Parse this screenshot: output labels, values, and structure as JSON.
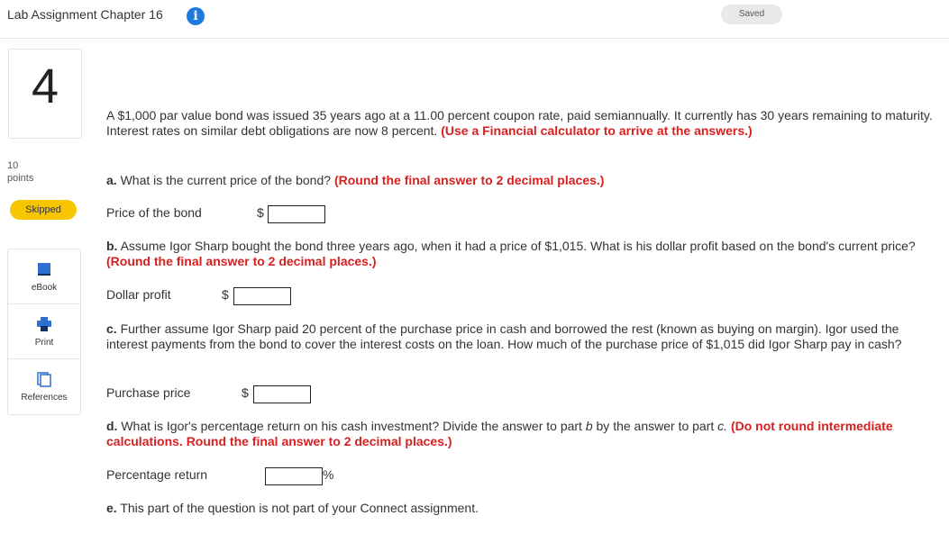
{
  "header": {
    "title": "Lab Assignment Chapter 16",
    "info_icon": "info-icon",
    "saved_label": "Saved"
  },
  "question": {
    "number": "4",
    "points_value": "10",
    "points_label": "points",
    "status": "Skipped"
  },
  "tools": [
    {
      "label": "eBook",
      "icon": "book-icon"
    },
    {
      "label": "Print",
      "icon": "printer-icon"
    },
    {
      "label": "References",
      "icon": "references-icon"
    }
  ],
  "content": {
    "intro": "A $1,000 par value bond was issued 35 years ago at a 11.00 percent coupon rate, paid semiannually. It currently has 30 years remaining to maturity. Interest rates on similar debt obligations are now 8 percent.",
    "intro_red": "(Use a Financial calculator to arrive at the answers.)",
    "a_label": "a.",
    "a_text": "What is the current price of the bond?",
    "a_red": "(Round the final answer to 2 decimal places.)",
    "a_field_label": "Price of the bond",
    "b_label": "b.",
    "b_text": "Assume Igor Sharp bought the bond three years ago, when it had a price of $1,015. What is his dollar profit based on the bond's current price?",
    "b_red": "(Round the final answer to 2 decimal places.)",
    "b_field_label": "Dollar profit",
    "c_label": "c.",
    "c_text": "Further assume Igor Sharp paid 20 percent of the purchase price in cash and borrowed the rest (known as buying on margin). Igor used the interest payments from the bond to cover the interest costs on the loan. How much of the purchase price of $1,015 did Igor Sharp pay in cash?",
    "c_field_label": "Purchase price",
    "d_label": "d.",
    "d_text_1": "What is Igor's percentage return on his cash investment? Divide the answer to part ",
    "d_italic_b": "b",
    "d_text_2": " by the answer to part ",
    "d_italic_c": "c.",
    "d_red": "(Do not round intermediate calculations. Round the final answer to 2 decimal places.)",
    "d_field_label": "Percentage return",
    "e_label": "e.",
    "e_text": "This part of the question is not part of your Connect assignment.",
    "currency": "$",
    "percent": "%",
    "fields": {
      "price": "",
      "profit": "",
      "purchase": "",
      "return": ""
    }
  },
  "colors": {
    "accent": "#1f7ae0",
    "warning": "#f7c600",
    "red": "#d91f1f"
  }
}
